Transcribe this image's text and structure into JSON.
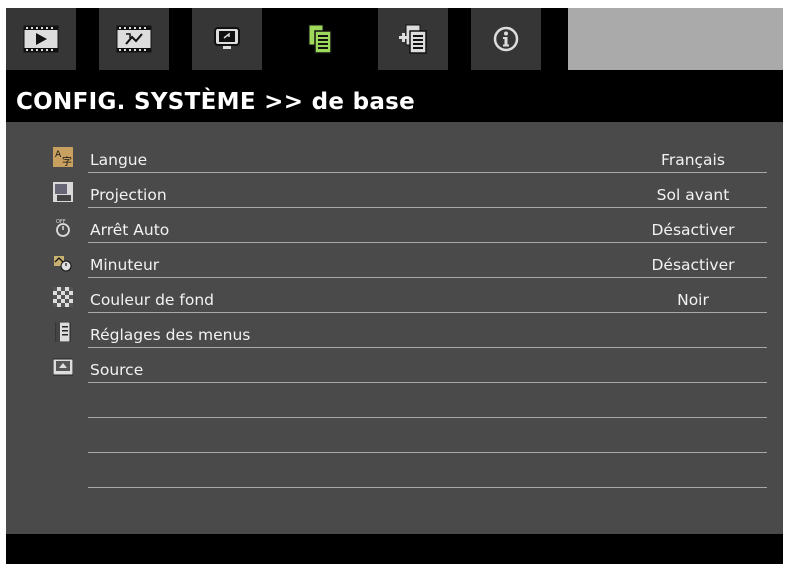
{
  "tabs": [
    {
      "icon": "image-tab-icon"
    },
    {
      "icon": "display-tab-icon"
    },
    {
      "icon": "setting-tab-icon"
    },
    {
      "icon": "system-basic-tab-icon",
      "selected": true
    },
    {
      "icon": "system-advanced-tab-icon"
    },
    {
      "icon": "information-tab-icon"
    }
  ],
  "header": {
    "title": "CONFIG. SYSTÈME >> de base"
  },
  "menu": {
    "items": [
      {
        "label": "Langue",
        "value": "Français",
        "icon": "language-icon"
      },
      {
        "label": "Projection",
        "value": "Sol avant",
        "icon": "projection-icon"
      },
      {
        "label": "Arrêt Auto",
        "value": "Désactiver",
        "icon": "auto-off-icon"
      },
      {
        "label": "Minuteur",
        "value": "Désactiver",
        "icon": "sleep-timer-icon"
      },
      {
        "label": "Couleur de fond",
        "value": "Noir",
        "icon": "background-color-icon"
      },
      {
        "label": "Réglages des menus",
        "value": "",
        "icon": "menu-settings-icon"
      },
      {
        "label": "Source",
        "value": "",
        "icon": "source-icon"
      }
    ]
  },
  "colors": {
    "tab_bg": "#363636",
    "tab_selected_icon": "#9ed85a",
    "panel_bg": "#4a4a4a",
    "divider": "#a8a8a8",
    "header_bg": "#000000"
  }
}
